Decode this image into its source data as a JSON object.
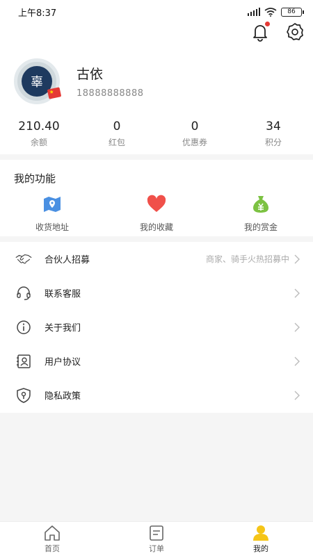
{
  "status_bar": {
    "time": "上午8:37",
    "battery": "86"
  },
  "profile": {
    "name": "古依",
    "phone": "18888888888",
    "avatar_glyph": "辜"
  },
  "stats": [
    {
      "value": "210.40",
      "label": "余额"
    },
    {
      "value": "0",
      "label": "红包"
    },
    {
      "value": "0",
      "label": "优惠券"
    },
    {
      "value": "34",
      "label": "积分"
    }
  ],
  "features": {
    "title": "我的功能",
    "items": [
      {
        "label": "收货地址",
        "icon": "map-icon"
      },
      {
        "label": "我的收藏",
        "icon": "heart-icon"
      },
      {
        "label": "我的赏金",
        "icon": "money-bag-icon"
      }
    ]
  },
  "menu": [
    {
      "label": "合伙人招募",
      "hint": "商家、骑手火热招募中",
      "icon": "handshake-icon"
    },
    {
      "label": "联系客服",
      "hint": "",
      "icon": "headset-icon"
    },
    {
      "label": "关于我们",
      "hint": "",
      "icon": "info-icon"
    },
    {
      "label": "用户协议",
      "hint": "",
      "icon": "user-doc-icon"
    },
    {
      "label": "隐私政策",
      "hint": "",
      "icon": "shield-icon"
    }
  ],
  "tabbar": [
    {
      "label": "首页",
      "icon": "home-icon"
    },
    {
      "label": "订单",
      "icon": "order-icon"
    },
    {
      "label": "我的",
      "icon": "profile-icon",
      "active": true
    }
  ],
  "colors": {
    "accent": "#f5c518",
    "heart": "#f0504a",
    "bag": "#7cc242",
    "map": "#4a90e2"
  }
}
